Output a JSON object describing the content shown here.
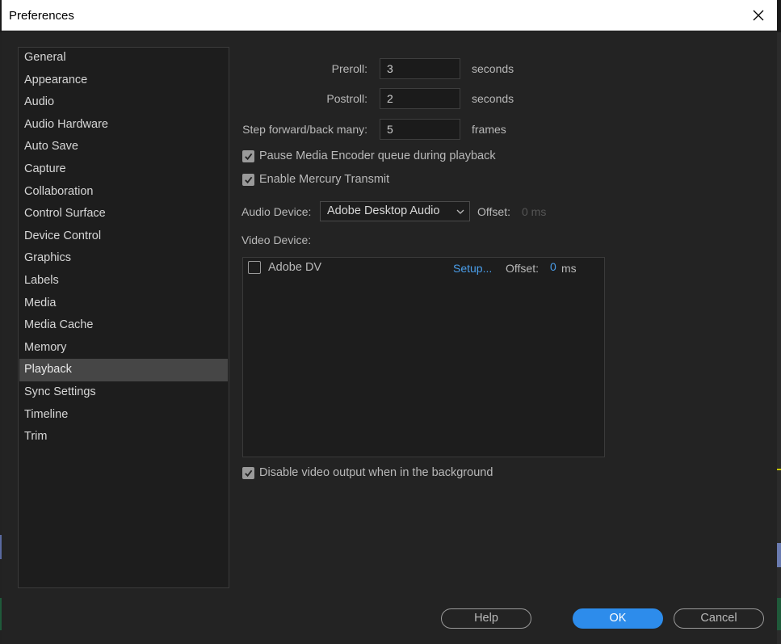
{
  "window": {
    "title": "Preferences"
  },
  "sidebar": {
    "items": [
      {
        "label": "General"
      },
      {
        "label": "Appearance"
      },
      {
        "label": "Audio"
      },
      {
        "label": "Audio Hardware"
      },
      {
        "label": "Auto Save"
      },
      {
        "label": "Capture"
      },
      {
        "label": "Collaboration"
      },
      {
        "label": "Control Surface"
      },
      {
        "label": "Device Control"
      },
      {
        "label": "Graphics"
      },
      {
        "label": "Labels"
      },
      {
        "label": "Media"
      },
      {
        "label": "Media Cache"
      },
      {
        "label": "Memory"
      },
      {
        "label": "Playback"
      },
      {
        "label": "Sync Settings"
      },
      {
        "label": "Timeline"
      },
      {
        "label": "Trim"
      }
    ],
    "active": "Playback"
  },
  "playback": {
    "preroll": {
      "label": "Preroll:",
      "value": "3",
      "unit": "seconds"
    },
    "postroll": {
      "label": "Postroll:",
      "value": "2",
      "unit": "seconds"
    },
    "step": {
      "label": "Step forward/back many:",
      "value": "5",
      "unit": "frames"
    },
    "pause_encoder": {
      "label": "Pause Media Encoder queue during playback",
      "checked": true
    },
    "mercury": {
      "label": "Enable Mercury Transmit",
      "checked": true
    },
    "audio_device": {
      "label": "Audio Device:",
      "selected": "Adobe Desktop Audio",
      "offset_label": "Offset:",
      "offset_value": "0 ms"
    },
    "video_device": {
      "label": "Video Device:",
      "devices": [
        {
          "name": "Adobe DV",
          "checked": false,
          "setup": "Setup...",
          "offset_label": "Offset:",
          "offset_value": "0",
          "offset_unit": "ms"
        }
      ]
    },
    "disable_bg": {
      "label": "Disable video output when in the background",
      "checked": true
    }
  },
  "buttons": {
    "help": "Help",
    "ok": "OK",
    "cancel": "Cancel"
  },
  "colors": {
    "accent": "#2d8ceb",
    "link": "#4a9eea",
    "background": "#232323"
  }
}
